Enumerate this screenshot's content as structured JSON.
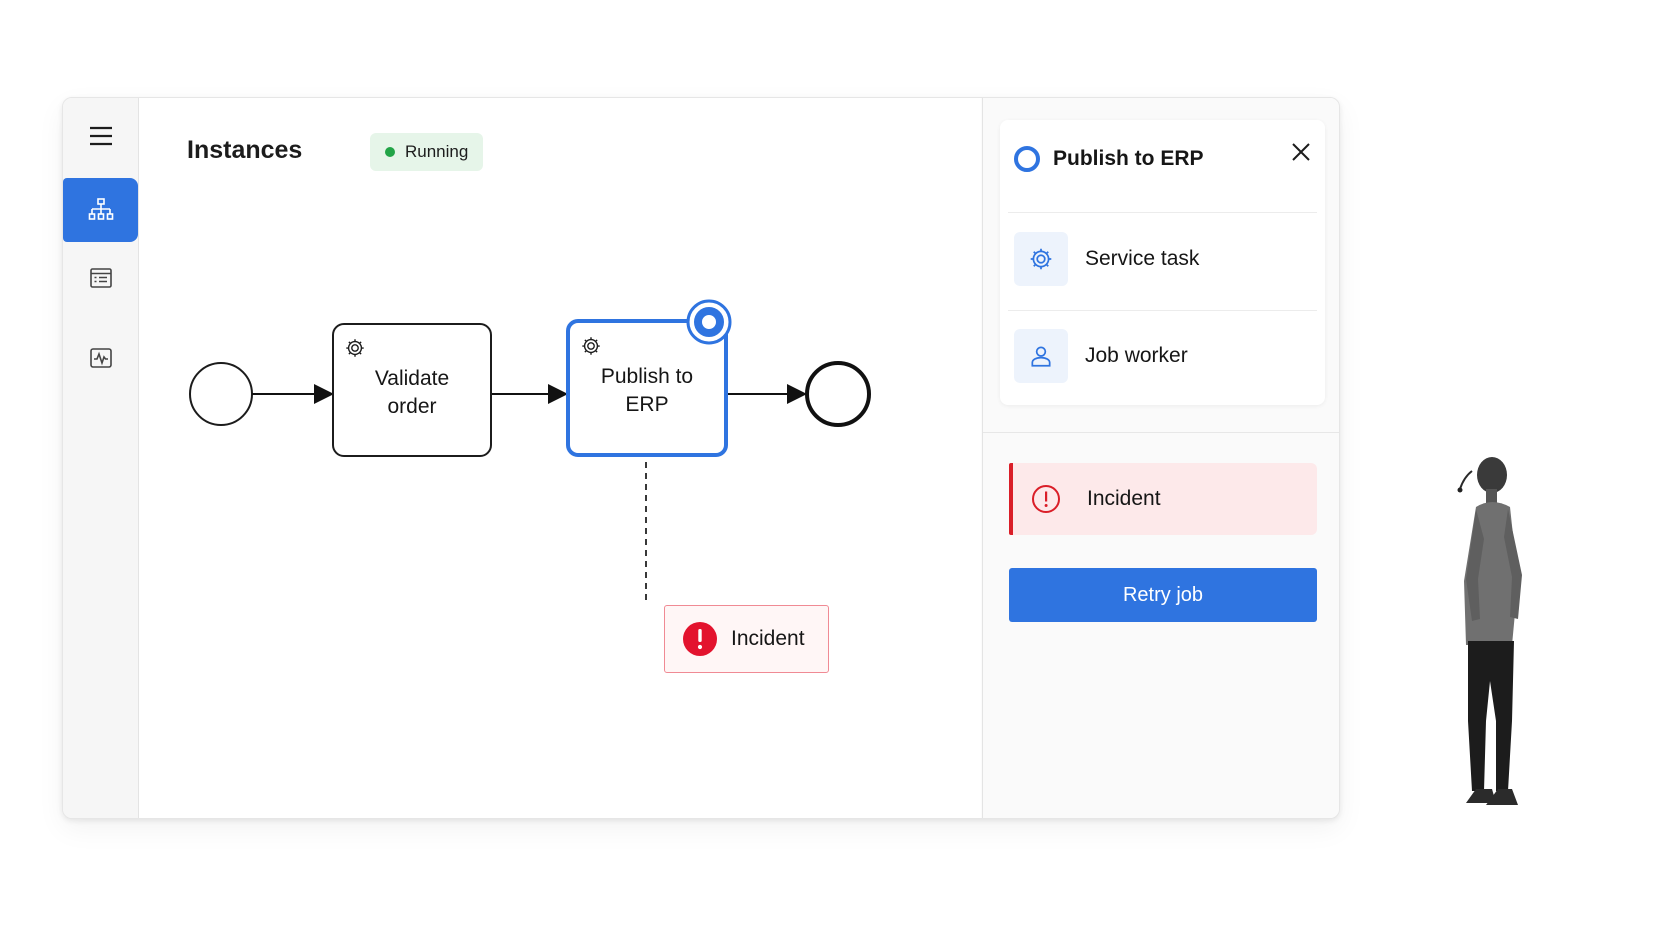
{
  "header": {
    "title": "Instances",
    "status": "Running"
  },
  "sidebar": {
    "items": [
      {
        "icon": "menu-icon"
      },
      {
        "icon": "process-diagram-icon",
        "active": true
      },
      {
        "icon": "list-icon"
      },
      {
        "icon": "activity-icon"
      }
    ]
  },
  "diagram": {
    "tasks": [
      {
        "label": "Validate\norder",
        "icon": "gear-icon"
      },
      {
        "label": "Publish to\nERP",
        "icon": "gear-icon",
        "selected": true
      }
    ],
    "incident_label": "Incident"
  },
  "panel": {
    "title": "Publish to ERP",
    "type_label": "Service task",
    "worker_label": "Job worker",
    "incident_label": "Incident",
    "retry_label": "Retry job"
  },
  "colors": {
    "accent": "#2f74e0",
    "running": "#22a447",
    "incident": "#da1e28"
  }
}
